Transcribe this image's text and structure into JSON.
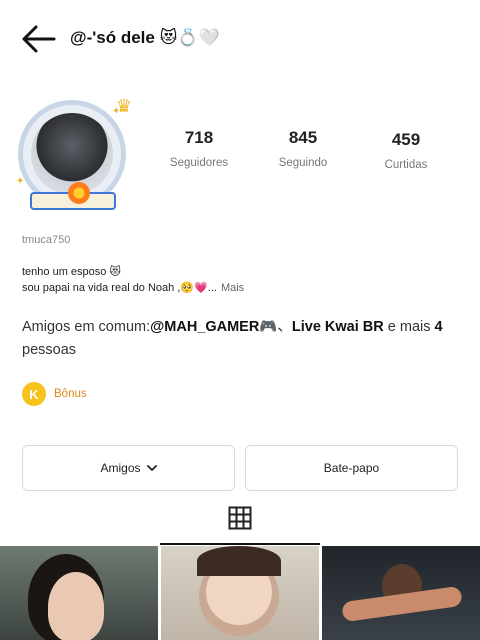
{
  "header": {
    "title": "@-'só dele 😻💍🤍",
    "back_icon": "arrow-left-icon"
  },
  "profile": {
    "avatar_icon": "avatar",
    "stats": [
      {
        "value": "718",
        "label": "Seguidores"
      },
      {
        "value": "845",
        "label": "Seguindo"
      },
      {
        "value": "459",
        "label": "Curtidas"
      }
    ],
    "username": "tmuca750",
    "bio_line1": "tenho um esposo 😻",
    "bio_line2": "sou papai na vida real do Noah ,🥺💗...",
    "bio_more": "Mais"
  },
  "mutual": {
    "prefix": "Amigos em comum:",
    "friend1": "@MAH_GAMER🎮",
    "separator": "、",
    "friend2": "Live Kwai BR",
    "suffix_and": " e mais ",
    "count": "4",
    "suffix": "pessoas"
  },
  "bonus": {
    "icon_letter": "K",
    "label": "Bônus",
    "color": "#e2881a"
  },
  "actions": {
    "friends_label": "Amigos",
    "chat_label": "Bate-papo"
  },
  "tabs": {
    "grid_icon": "grid-icon"
  },
  "videos": [
    {
      "name": "video-thumb-1"
    },
    {
      "name": "video-thumb-2"
    },
    {
      "name": "video-thumb-3"
    }
  ]
}
